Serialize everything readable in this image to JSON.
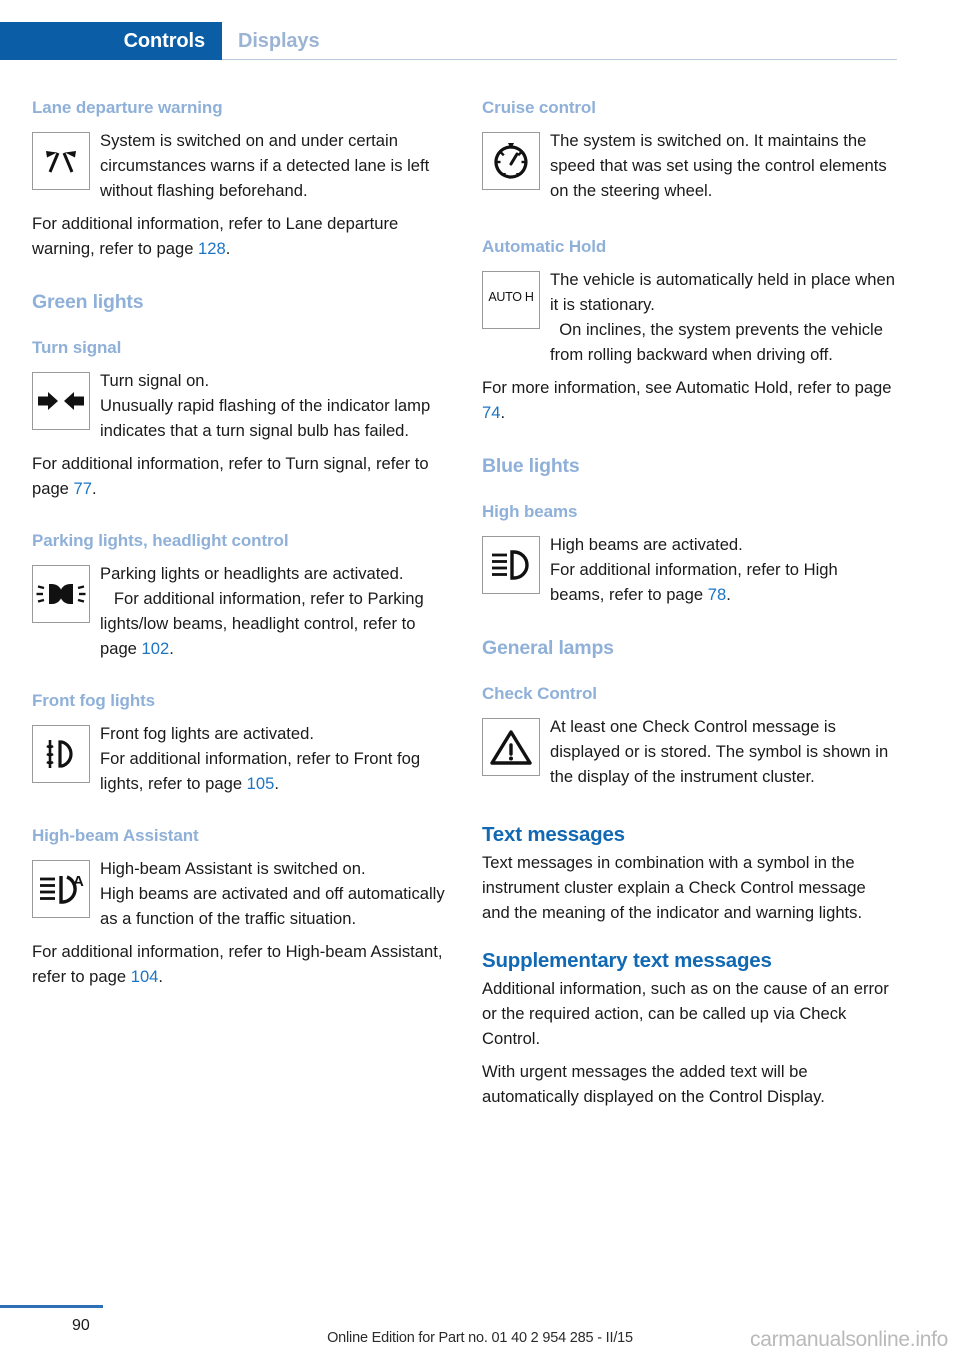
{
  "header": {
    "active_tab": "Controls",
    "inactive_tab": "Displays",
    "active_color": "#0b5ea6",
    "inactive_color": "#9cb4d4"
  },
  "left_column": {
    "lane_departure": {
      "heading": "Lane departure warning",
      "icon": "lane-departure-warning-icon",
      "text_1": "System is switched on and under certain circumstances warns if a detected lane is left without flashing beforehand.",
      "text_2_pre": "For additional information, refer to Lane departure warning, refer to page ",
      "text_2_ref": "128",
      "text_2_post": "."
    },
    "green_lights_heading": "Green lights",
    "turn_signal": {
      "heading": "Turn signal",
      "icon": "turn-signal-icon",
      "text_1": "Turn signal on.",
      "text_2": "Unusually rapid flashing of the indicator lamp indicates that a turn signal bulb has failed.",
      "text_3_pre": "For additional information, refer to Turn signal, refer to page ",
      "text_3_ref": "77",
      "text_3_post": "."
    },
    "parking_lights": {
      "heading": "Parking lights, headlight control",
      "icon": "parking-lights-icon",
      "text_1": "Parking lights or headlights are activated.",
      "text_2_pre": "For additional information, refer to Parking lights/low beams, headlight control, refer to page ",
      "text_2_ref": "102",
      "text_2_post": "."
    },
    "front_fog_lights": {
      "heading": "Front fog lights",
      "icon": "front-fog-lights-icon",
      "text_1": "Front fog lights are activated.",
      "text_2_pre": "For additional information, refer to Front fog lights, refer to page ",
      "text_2_ref": "105",
      "text_2_post": "."
    },
    "high_beam_assistant": {
      "heading": "High-beam Assistant",
      "icon": "high-beam-assistant-icon",
      "text_1": "High-beam Assistant is switched on.",
      "text_2": "High beams are activated and off automatically as a function of the traffic situation.",
      "text_3_pre": "For additional information, refer to High-beam Assistant, refer to page ",
      "text_3_ref": "104",
      "text_3_post": "."
    }
  },
  "right_column": {
    "cruise_control": {
      "heading": "Cruise control",
      "icon": "cruise-control-icon",
      "text_1": "The system is switched on. It maintains the speed that was set using the control elements on the steering wheel."
    },
    "automatic_hold": {
      "heading": "Automatic Hold",
      "icon": "auto-hold-icon",
      "icon_label": "AUTO H",
      "text_1": "The vehicle is automatically held in place when it is stationary.",
      "text_2": "On inclines, the system prevents the vehicle from rolling backward when driving off.",
      "text_3_pre": "For more information, see Automatic Hold, refer to page ",
      "text_3_ref": "74",
      "text_3_post": "."
    },
    "blue_lights_heading": "Blue lights",
    "high_beams": {
      "heading": "High beams",
      "icon": "high-beams-icon",
      "text_1": "High beams are activated.",
      "text_2_pre": "For additional information, refer to High beams, refer to page ",
      "text_2_ref": "78",
      "text_2_post": "."
    },
    "general_lamps_heading": "General lamps",
    "check_control": {
      "heading": "Check Control",
      "icon": "check-control-warning-icon",
      "text_1": "At least one Check Control message is displayed or is stored. The symbol is shown in the display of the instrument cluster."
    },
    "text_messages": {
      "heading": "Text messages",
      "text_1": "Text messages in combination with a symbol in the instrument cluster explain a Check Control message and the meaning of the indicator and warning lights."
    },
    "supplementary_text_messages": {
      "heading": "Supplementary text messages",
      "text_1": "Additional information, such as on the cause of an error or the required action, can be called up via Check Control.",
      "text_2": "With urgent messages the added text will be automatically displayed on the Control Display."
    }
  },
  "footer": {
    "page_number": "90",
    "edition_note": "Online Edition for Part no. 01 40 2 954 285 - II/15",
    "watermark": "carmanualsonline.info"
  }
}
